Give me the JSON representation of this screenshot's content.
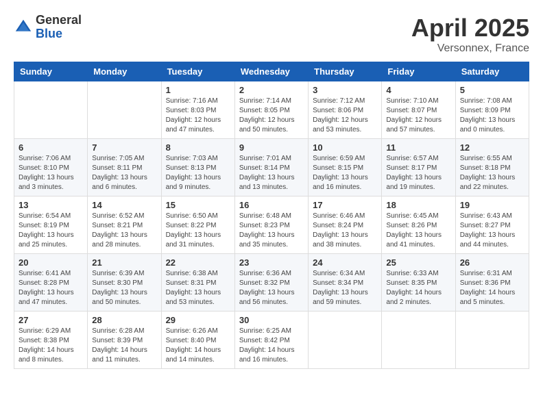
{
  "header": {
    "logo_general": "General",
    "logo_blue": "Blue",
    "month_title": "April 2025",
    "location": "Versonnex, France"
  },
  "weekdays": [
    "Sunday",
    "Monday",
    "Tuesday",
    "Wednesday",
    "Thursday",
    "Friday",
    "Saturday"
  ],
  "weeks": [
    [
      {
        "day": "",
        "info": ""
      },
      {
        "day": "",
        "info": ""
      },
      {
        "day": "1",
        "info": "Sunrise: 7:16 AM\nSunset: 8:03 PM\nDaylight: 12 hours and 47 minutes."
      },
      {
        "day": "2",
        "info": "Sunrise: 7:14 AM\nSunset: 8:05 PM\nDaylight: 12 hours and 50 minutes."
      },
      {
        "day": "3",
        "info": "Sunrise: 7:12 AM\nSunset: 8:06 PM\nDaylight: 12 hours and 53 minutes."
      },
      {
        "day": "4",
        "info": "Sunrise: 7:10 AM\nSunset: 8:07 PM\nDaylight: 12 hours and 57 minutes."
      },
      {
        "day": "5",
        "info": "Sunrise: 7:08 AM\nSunset: 8:09 PM\nDaylight: 13 hours and 0 minutes."
      }
    ],
    [
      {
        "day": "6",
        "info": "Sunrise: 7:06 AM\nSunset: 8:10 PM\nDaylight: 13 hours and 3 minutes."
      },
      {
        "day": "7",
        "info": "Sunrise: 7:05 AM\nSunset: 8:11 PM\nDaylight: 13 hours and 6 minutes."
      },
      {
        "day": "8",
        "info": "Sunrise: 7:03 AM\nSunset: 8:13 PM\nDaylight: 13 hours and 9 minutes."
      },
      {
        "day": "9",
        "info": "Sunrise: 7:01 AM\nSunset: 8:14 PM\nDaylight: 13 hours and 13 minutes."
      },
      {
        "day": "10",
        "info": "Sunrise: 6:59 AM\nSunset: 8:15 PM\nDaylight: 13 hours and 16 minutes."
      },
      {
        "day": "11",
        "info": "Sunrise: 6:57 AM\nSunset: 8:17 PM\nDaylight: 13 hours and 19 minutes."
      },
      {
        "day": "12",
        "info": "Sunrise: 6:55 AM\nSunset: 8:18 PM\nDaylight: 13 hours and 22 minutes."
      }
    ],
    [
      {
        "day": "13",
        "info": "Sunrise: 6:54 AM\nSunset: 8:19 PM\nDaylight: 13 hours and 25 minutes."
      },
      {
        "day": "14",
        "info": "Sunrise: 6:52 AM\nSunset: 8:21 PM\nDaylight: 13 hours and 28 minutes."
      },
      {
        "day": "15",
        "info": "Sunrise: 6:50 AM\nSunset: 8:22 PM\nDaylight: 13 hours and 31 minutes."
      },
      {
        "day": "16",
        "info": "Sunrise: 6:48 AM\nSunset: 8:23 PM\nDaylight: 13 hours and 35 minutes."
      },
      {
        "day": "17",
        "info": "Sunrise: 6:46 AM\nSunset: 8:24 PM\nDaylight: 13 hours and 38 minutes."
      },
      {
        "day": "18",
        "info": "Sunrise: 6:45 AM\nSunset: 8:26 PM\nDaylight: 13 hours and 41 minutes."
      },
      {
        "day": "19",
        "info": "Sunrise: 6:43 AM\nSunset: 8:27 PM\nDaylight: 13 hours and 44 minutes."
      }
    ],
    [
      {
        "day": "20",
        "info": "Sunrise: 6:41 AM\nSunset: 8:28 PM\nDaylight: 13 hours and 47 minutes."
      },
      {
        "day": "21",
        "info": "Sunrise: 6:39 AM\nSunset: 8:30 PM\nDaylight: 13 hours and 50 minutes."
      },
      {
        "day": "22",
        "info": "Sunrise: 6:38 AM\nSunset: 8:31 PM\nDaylight: 13 hours and 53 minutes."
      },
      {
        "day": "23",
        "info": "Sunrise: 6:36 AM\nSunset: 8:32 PM\nDaylight: 13 hours and 56 minutes."
      },
      {
        "day": "24",
        "info": "Sunrise: 6:34 AM\nSunset: 8:34 PM\nDaylight: 13 hours and 59 minutes."
      },
      {
        "day": "25",
        "info": "Sunrise: 6:33 AM\nSunset: 8:35 PM\nDaylight: 14 hours and 2 minutes."
      },
      {
        "day": "26",
        "info": "Sunrise: 6:31 AM\nSunset: 8:36 PM\nDaylight: 14 hours and 5 minutes."
      }
    ],
    [
      {
        "day": "27",
        "info": "Sunrise: 6:29 AM\nSunset: 8:38 PM\nDaylight: 14 hours and 8 minutes."
      },
      {
        "day": "28",
        "info": "Sunrise: 6:28 AM\nSunset: 8:39 PM\nDaylight: 14 hours and 11 minutes."
      },
      {
        "day": "29",
        "info": "Sunrise: 6:26 AM\nSunset: 8:40 PM\nDaylight: 14 hours and 14 minutes."
      },
      {
        "day": "30",
        "info": "Sunrise: 6:25 AM\nSunset: 8:42 PM\nDaylight: 14 hours and 16 minutes."
      },
      {
        "day": "",
        "info": ""
      },
      {
        "day": "",
        "info": ""
      },
      {
        "day": "",
        "info": ""
      }
    ]
  ]
}
